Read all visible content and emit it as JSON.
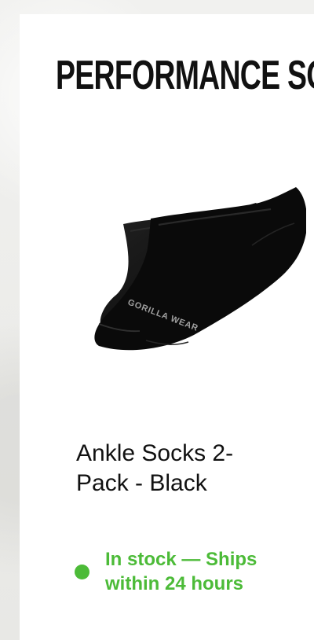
{
  "section": {
    "title": "PERFORMANCE SOCKS"
  },
  "product": {
    "name": "Ankle Socks 2-Pack - Black",
    "image_icon": "socks-image",
    "brand_print": "GORILLA WEAR",
    "stock_status": "In stock — Ships within 24 hours",
    "stock_color": "#4cbb38",
    "stock_icon": "stock-status-dot"
  },
  "colors": {
    "background": "#ececea",
    "card": "#ffffff",
    "text": "#111111",
    "sock": "#0d0d0d"
  }
}
